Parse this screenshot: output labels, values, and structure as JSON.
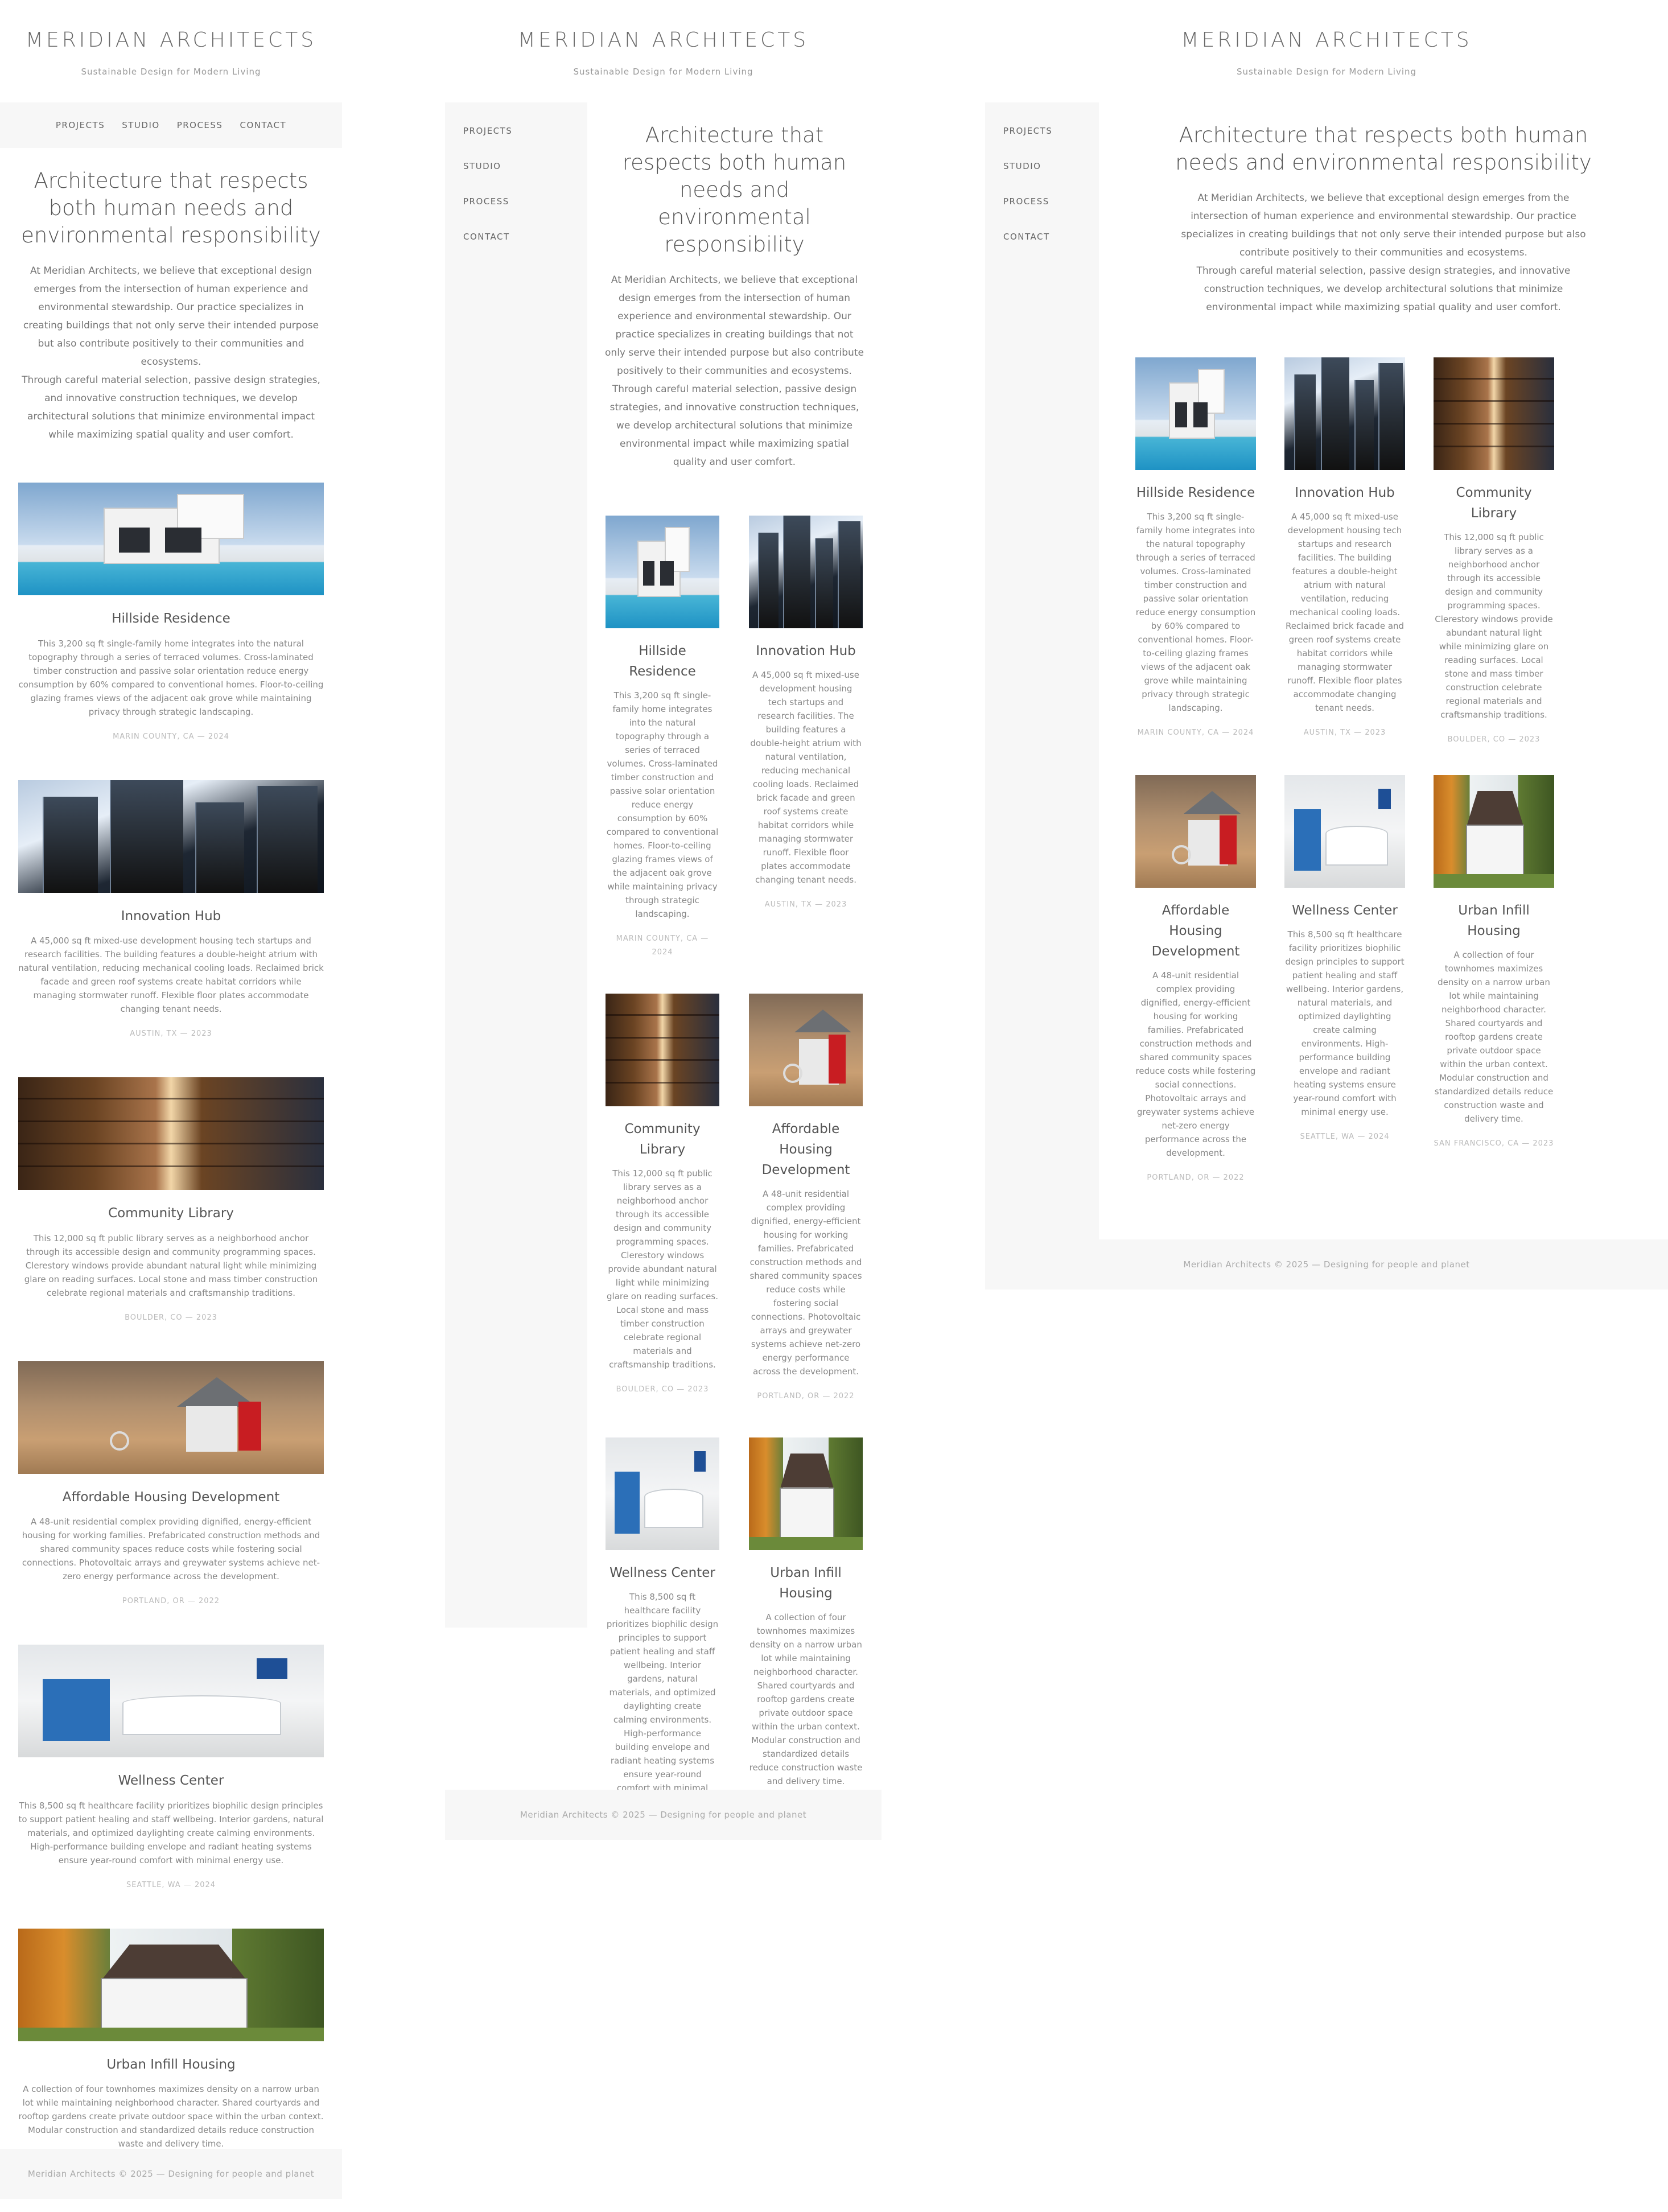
{
  "brand": {
    "name": "MERIDIAN ARCHITECTS",
    "tagline": "Sustainable Design for Modern Living"
  },
  "nav": {
    "items": [
      "PROJECTS",
      "STUDIO",
      "PROCESS",
      "CONTACT"
    ]
  },
  "intro": {
    "heading": "Architecture that respects both human needs and environmental responsibility",
    "paragraph1": "At Meridian Architects, we believe that exceptional design emerges from the intersection of human experience and environmental stewardship. Our practice specializes in creating buildings that not only serve their intended purpose but also contribute positively to their communities and ecosystems.",
    "paragraph2": "Through careful material selection, passive design strategies, and innovative construction techniques, we develop architectural solutions that minimize environmental impact while maximizing spatial quality and user comfort."
  },
  "projects": [
    {
      "title": "Hillside Residence",
      "image": "modern-villa-with-pool",
      "description": "This 3,200 sq ft single-family home integrates into the natural topography through a series of terraced volumes. Cross-laminated timber construction and passive solar orientation reduce energy consumption by 60% compared to conventional homes. Floor-to-ceiling glazing frames views of the adjacent oak grove while maintaining privacy through strategic landscaping.",
      "meta": "MARIN COUNTY, CA — 2024"
    },
    {
      "title": "Innovation Hub",
      "image": "glass-towers-skyward",
      "description": "A 45,000 sq ft mixed-use development housing tech startups and research facilities. The building features a double-height atrium with natural ventilation, reducing mechanical cooling loads. Reclaimed brick facade and green roof systems create habitat corridors while managing stormwater runoff. Flexible floor plates accommodate changing tenant needs.",
      "meta": "AUSTIN, TX — 2023"
    },
    {
      "title": "Community Library",
      "image": "library-bookshelves",
      "description": "This 12,000 sq ft public library serves as a neighborhood anchor through its accessible design and community programming spaces. Clerestory windows provide abundant natural light while minimizing glare on reading surfaces. Local stone and mass timber construction celebrate regional materials and craftsmanship traditions.",
      "meta": "BOULDER, CO — 2023"
    },
    {
      "title": "Affordable Housing Development",
      "image": "model-house-with-keys",
      "description": "A 48-unit residential complex providing dignified, energy-efficient housing for working families. Prefabricated construction methods and shared community spaces reduce costs while fostering social connections. Photovoltaic arrays and greywater systems achieve net-zero energy performance across the development.",
      "meta": "PORTLAND, OR — 2022"
    },
    {
      "title": "Wellness Center",
      "image": "clinic-reception",
      "description": "This 8,500 sq ft healthcare facility prioritizes biophilic design principles to support patient healing and staff wellbeing. Interior gardens, natural materials, and optimized daylighting create calming environments. High-performance building envelope and radiant heating systems ensure year-round comfort with minimal energy use.",
      "meta": "SEATTLE, WA — 2024"
    },
    {
      "title": "Urban Infill Housing",
      "image": "townhouse-in-autumn",
      "description": "A collection of four townhomes maximizes density on a narrow urban lot while maintaining neighborhood character. Shared courtyards and rooftop gardens create private outdoor space within the urban context. Modular construction and standardized details reduce construction waste and delivery time.",
      "meta": "SAN FRANCISCO, CA — 2023"
    }
  ],
  "footer": {
    "text": "Meridian Architects © 2025 — Designing for people and planet"
  }
}
